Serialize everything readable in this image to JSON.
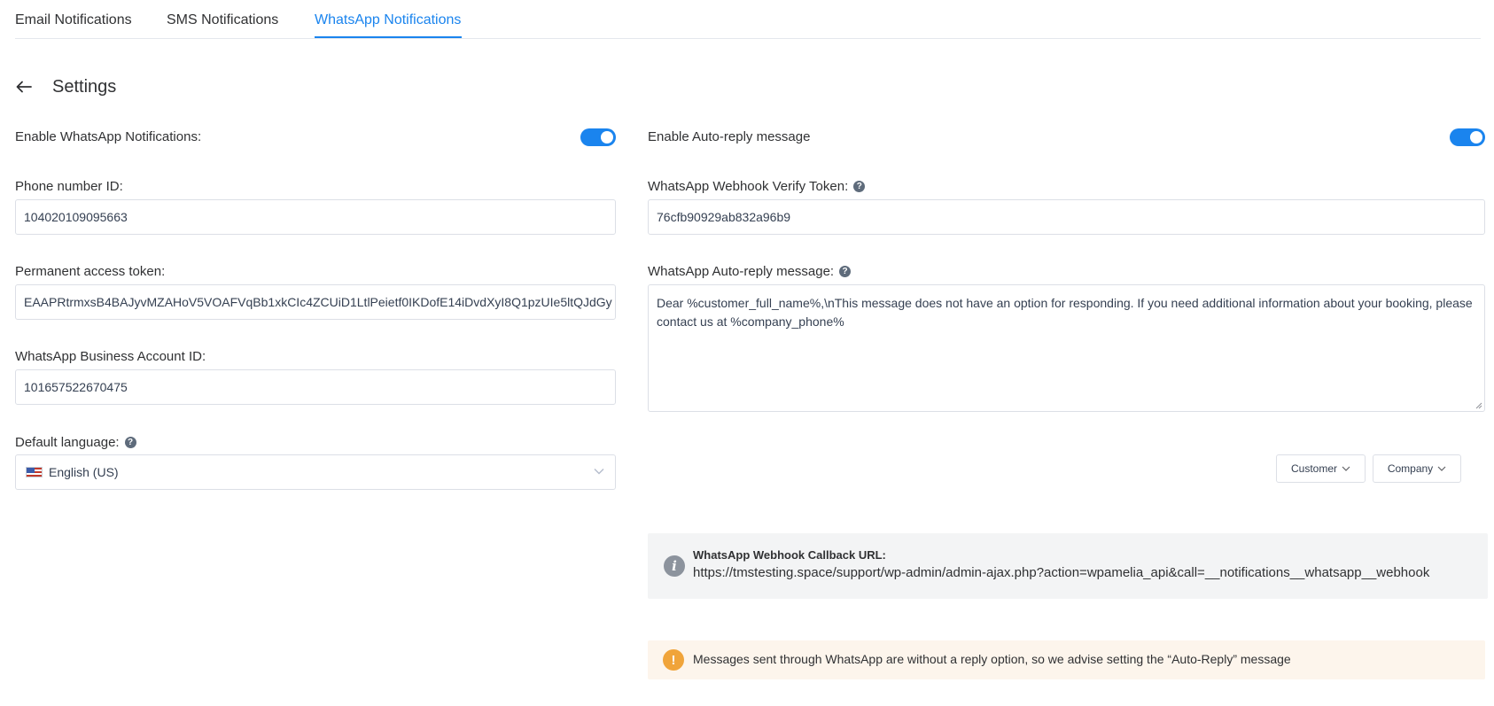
{
  "tabs": [
    {
      "label": "Email Notifications",
      "active": false
    },
    {
      "label": "SMS Notifications",
      "active": false
    },
    {
      "label": "WhatsApp Notifications",
      "active": true
    }
  ],
  "header": {
    "title": "Settings",
    "back_icon": "arrow-left-icon"
  },
  "left": {
    "enable_label": "Enable WhatsApp Notifications:",
    "enable_on": true,
    "phone_label": "Phone number ID:",
    "phone_value": "104020109095663",
    "token_label": "Permanent access token:",
    "token_value": "EAAPRtrmxsB4BAJyvMZAHoV5VOAFVqBb1xkCIc4ZCUiD1LtlPeietf0IKDofE14iDvdXyI8Q1pzUIe5ltQJdGy",
    "business_label": "WhatsApp Business Account ID:",
    "business_value": "101657522670475",
    "language_label": "Default language:",
    "language_value": "English (US)"
  },
  "right": {
    "autoreply_label": "Enable Auto-reply message",
    "autoreply_on": true,
    "verify_label": "WhatsApp Webhook Verify Token:",
    "verify_value": "76cfb90929ab832a96b9",
    "message_label": "WhatsApp Auto-reply message:",
    "message_value": "Dear %customer_full_name%,\\nThis message does not have an option for responding. If you need additional information about your booking, please contact us at %company_phone%",
    "placeholders": [
      "Customer",
      "Company"
    ]
  },
  "info": {
    "title": "WhatsApp Webhook Callback URL:",
    "url": "https://tmstesting.space/support/wp-admin/admin-ajax.php?action=wpamelia_api&call=__notifications__whatsapp__webhook"
  },
  "warning": {
    "text": "Messages sent through WhatsApp are without a reply option, so we advise setting the “Auto-Reply” message"
  },
  "colors": {
    "accent": "#1a84ee",
    "warning": "#f0a43a",
    "info_icon": "#8c939d"
  }
}
